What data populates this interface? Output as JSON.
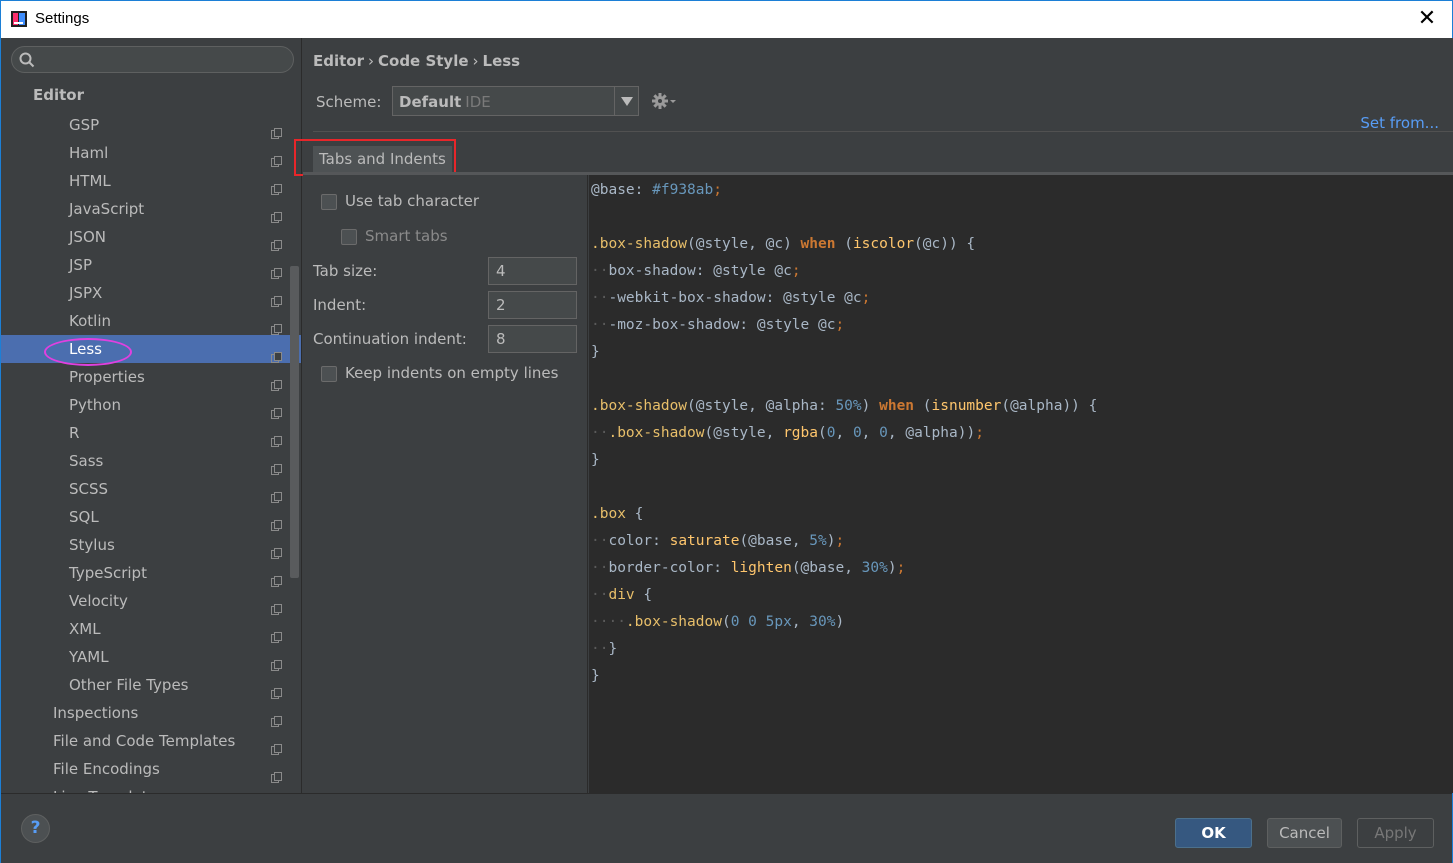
{
  "window": {
    "title": "Settings"
  },
  "sidebar": {
    "search_placeholder": "",
    "section": "Editor",
    "items": [
      {
        "label": "GSP"
      },
      {
        "label": "Haml"
      },
      {
        "label": "HTML"
      },
      {
        "label": "JavaScript"
      },
      {
        "label": "JSON"
      },
      {
        "label": "JSP"
      },
      {
        "label": "JSPX"
      },
      {
        "label": "Kotlin"
      },
      {
        "label": "Less"
      },
      {
        "label": "Properties"
      },
      {
        "label": "Python"
      },
      {
        "label": "R"
      },
      {
        "label": "Sass"
      },
      {
        "label": "SCSS"
      },
      {
        "label": "SQL"
      },
      {
        "label": "Stylus"
      },
      {
        "label": "TypeScript"
      },
      {
        "label": "Velocity"
      },
      {
        "label": "XML"
      },
      {
        "label": "YAML"
      },
      {
        "label": "Other File Types"
      }
    ],
    "top_items": [
      {
        "label": "Inspections"
      },
      {
        "label": "File and Code Templates"
      },
      {
        "label": "File Encodings"
      },
      {
        "label": "Live Templates"
      }
    ],
    "selected": "Less"
  },
  "breadcrumb": [
    "Editor",
    "Code Style",
    "Less"
  ],
  "breadcrumb_sep": "›",
  "scheme": {
    "label": "Scheme:",
    "value": "Default",
    "suffix": "IDE"
  },
  "set_from": "Set from...",
  "tabs": [
    {
      "label": "Tabs and Indents"
    }
  ],
  "options": {
    "use_tab": "Use tab character",
    "smart_tabs": "Smart tabs",
    "tab_size_label": "Tab size:",
    "tab_size": "4",
    "indent_label": "Indent:",
    "indent": "2",
    "cont_indent_label": "Continuation indent:",
    "cont_indent": "8",
    "keep_indents": "Keep indents on empty lines"
  },
  "buttons": {
    "ok": "OK",
    "cancel": "Cancel",
    "apply": "Apply",
    "help": "?"
  },
  "colors": {
    "selection": "#4b6eaf",
    "link": "#589df6",
    "highlight_box": "#e8262a",
    "ellipse": "#e040e0"
  }
}
